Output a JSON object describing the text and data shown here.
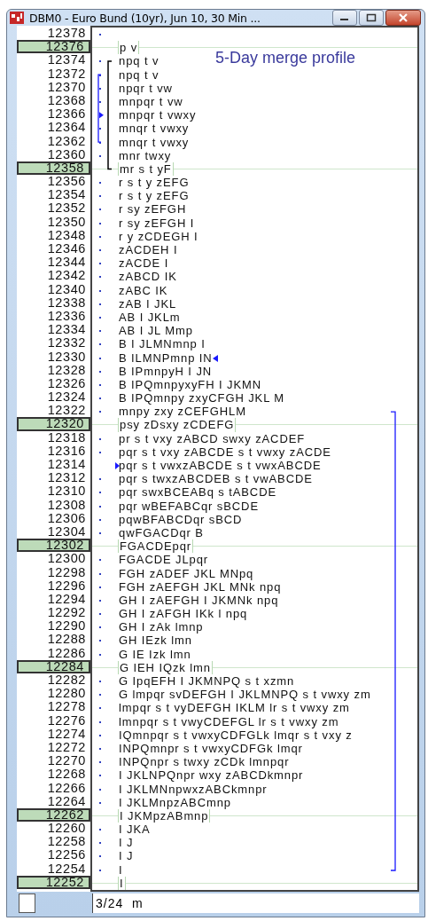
{
  "window": {
    "title": "DBM0 - Euro Bund (10yr), Jun 10, 30 Min ..."
  },
  "profile_label": "5-Day merge profile",
  "rows": [
    {
      "price": "12378",
      "highlighted": false
    },
    {
      "price": "12376",
      "letters": "p v",
      "highlighted": true
    },
    {
      "price": "12374",
      "letters": "npq t v",
      "highlighted": false
    },
    {
      "price": "12372",
      "letters": "npq t v",
      "highlighted": false
    },
    {
      "price": "12370",
      "letters": "npqr t vw",
      "highlighted": false
    },
    {
      "price": "12368",
      "letters": "mnpqr t vw",
      "highlighted": false
    },
    {
      "price": "12366",
      "letters": "mnpqr t vwxy",
      "highlighted": false
    },
    {
      "price": "12364",
      "letters": "mnqr t vwxy",
      "highlighted": false
    },
    {
      "price": "12362",
      "letters": "mnqr t vwxy",
      "highlighted": false
    },
    {
      "price": "12360",
      "letters": "mnr twxy",
      "highlighted": false
    },
    {
      "price": "12358",
      "letters": "mr s t yF",
      "highlighted": true
    },
    {
      "price": "12356",
      "letters": "r s t y zEFG",
      "highlighted": false
    },
    {
      "price": "12354",
      "letters": "r s t y zEFG",
      "highlighted": false
    },
    {
      "price": "12352",
      "letters": "r sy zEFGH",
      "highlighted": false
    },
    {
      "price": "12350",
      "letters": "r sy zEFGH I",
      "highlighted": false
    },
    {
      "price": "12348",
      "letters": "r y zCDEGH I",
      "highlighted": false
    },
    {
      "price": "12346",
      "letters": "zACDEH I",
      "highlighted": false
    },
    {
      "price": "12344",
      "letters": "zACDE I",
      "highlighted": false
    },
    {
      "price": "12342",
      "letters": "zABCD IK",
      "highlighted": false
    },
    {
      "price": "12340",
      "letters": "zABC IK",
      "highlighted": false
    },
    {
      "price": "12338",
      "letters": "zAB I JKL",
      "highlighted": false
    },
    {
      "price": "12336",
      "letters": "AB I JKLm",
      "highlighted": false
    },
    {
      "price": "12334",
      "letters": "AB I JL Mmp",
      "highlighted": false
    },
    {
      "price": "12332",
      "letters": "B I JLMNmnp I",
      "highlighted": false
    },
    {
      "price": "12330",
      "letters": "B ILMNPmnp IN",
      "highlighted": false
    },
    {
      "price": "12328",
      "letters": "B IPmnpyH I JN",
      "highlighted": false
    },
    {
      "price": "12326",
      "letters": "B IPQmnpyxyFH I JKMN",
      "highlighted": false
    },
    {
      "price": "12324",
      "letters": "B IPQmnpy zxyCFGH JKL M",
      "highlighted": false
    },
    {
      "price": "12322",
      "letters": "mnpy zxy zCEFGHLM",
      "highlighted": false
    },
    {
      "price": "12320",
      "letters": "psy zDsxy zCDEFG",
      "highlighted": true
    },
    {
      "price": "12318",
      "letters": "pr s t vxy zABCD swxy zACDEF",
      "highlighted": false
    },
    {
      "price": "12316",
      "letters": "pqr s t vxy zABCDE s t vwxy zACDE",
      "highlighted": false
    },
    {
      "price": "12314",
      "letters": "pqr s t vwxzABCDE s t vwxABCDE",
      "highlighted": false
    },
    {
      "price": "12312",
      "letters": "pqr s twxzABCDEB s t vwABCDE",
      "highlighted": false
    },
    {
      "price": "12310",
      "letters": "pqr swxBCEABq s tABCDE",
      "highlighted": false
    },
    {
      "price": "12308",
      "letters": "pqr wBEFABCqr sBCDE",
      "highlighted": false
    },
    {
      "price": "12306",
      "letters": "pqwBFABCDqr sBCD",
      "highlighted": false
    },
    {
      "price": "12304",
      "letters": "qwFGACDqr B",
      "highlighted": false
    },
    {
      "price": "12302",
      "letters": "FGACDEpqr",
      "highlighted": true
    },
    {
      "price": "12300",
      "letters": "FGACDE JLpqr",
      "highlighted": false
    },
    {
      "price": "12298",
      "letters": "FGH zADEF JKL MNpq",
      "highlighted": false
    },
    {
      "price": "12296",
      "letters": "FGH zAEFGH JKL MNk npq",
      "highlighted": false
    },
    {
      "price": "12294",
      "letters": "GH I zAEFGH I JKMNk npq",
      "highlighted": false
    },
    {
      "price": "12292",
      "letters": "GH I zAFGH IKk l npq",
      "highlighted": false
    },
    {
      "price": "12290",
      "letters": "GH I zAk lmnp",
      "highlighted": false
    },
    {
      "price": "12288",
      "letters": "GH IEzk lmn",
      "highlighted": false
    },
    {
      "price": "12286",
      "letters": "G IE Izk lmn",
      "highlighted": false
    },
    {
      "price": "12284",
      "letters": "G IEH IQzk lmn",
      "highlighted": true
    },
    {
      "price": "12282",
      "letters": "G IpqEFH I JKMNPQ s t xzmn",
      "highlighted": false
    },
    {
      "price": "12280",
      "letters": "G lmpqr svDEFGH I JKLMNPQ s t vwxy zm",
      "highlighted": false
    },
    {
      "price": "12278",
      "letters": "lmpqr s t vyDEFGH IKLM lr s t vwxy zm",
      "highlighted": false
    },
    {
      "price": "12276",
      "letters": "lmnpqr s t vwyCDEFGL lr s t vwxy zm",
      "highlighted": false
    },
    {
      "price": "12274",
      "letters": "IQmnpqr s t vwxyCDFGLk lmqr s t vxy z",
      "highlighted": false
    },
    {
      "price": "12272",
      "letters": "INPQmnpr s t vwxyCDFGk lmqr",
      "highlighted": false
    },
    {
      "price": "12270",
      "letters": "INPQnpr s twxy zCDk lmnpqr",
      "highlighted": false
    },
    {
      "price": "12268",
      "letters": "I JKLNPQnpr wxy zABCDkmnpr",
      "highlighted": false
    },
    {
      "price": "12266",
      "letters": "I JKLMNnpwxzABCkmnpr",
      "highlighted": false
    },
    {
      "price": "12264",
      "letters": "I JKLMnpzABCmnp",
      "highlighted": false
    },
    {
      "price": "12262",
      "letters": "I JKMpzABmnp",
      "highlighted": true
    },
    {
      "price": "12260",
      "letters": "I JKA",
      "highlighted": false
    },
    {
      "price": "12258",
      "letters": "I J",
      "highlighted": false
    },
    {
      "price": "12256",
      "letters": "I J",
      "highlighted": false
    },
    {
      "price": "12254",
      "letters": "I",
      "highlighted": false
    },
    {
      "price": "12252",
      "letters": "I",
      "highlighted": true
    }
  ],
  "status_field": {
    "value": "3/24  m"
  }
}
